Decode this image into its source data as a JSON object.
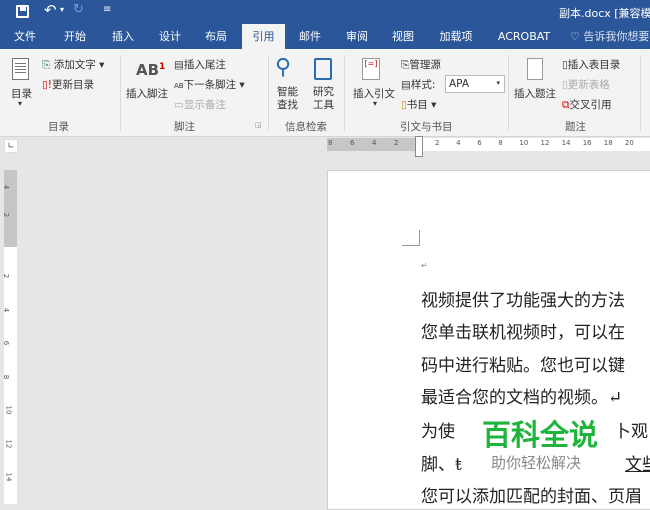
{
  "titlebar": {
    "title": "副本.docx [兼容模式]",
    "save_icon": "save-icon",
    "undo_icon": "undo-icon",
    "redo_icon": "redo-icon",
    "customize": "≡"
  },
  "tabs": [
    "文件",
    "开始",
    "插入",
    "设计",
    "布局",
    "引用",
    "邮件",
    "审阅",
    "视图",
    "加载项",
    "ACROBAT"
  ],
  "active_tab": "引用",
  "tell_me": "告诉我你想要做什么",
  "ribbon": {
    "toc": {
      "label": "目录",
      "add_text": "添加文字",
      "update": "更新目录",
      "group": "目录"
    },
    "footnotes": {
      "insert_footnote": "插入脚注",
      "insert_endnote": "插入尾注",
      "next_footnote": "下一条脚注",
      "show_notes": "显示备注",
      "group": "脚注"
    },
    "research": {
      "smart_lookup_1": "智能",
      "smart_lookup_2": "查找",
      "researcher_1": "研究",
      "researcher_2": "工具",
      "group": "信息检索"
    },
    "citations": {
      "insert_citation": "插入引文",
      "manage_sources": "管理源",
      "style_label": "样式:",
      "style_value": "APA",
      "bibliography": "书目",
      "group": "引文与书目"
    },
    "captions": {
      "insert_caption": "插入题注",
      "insert_table_figures": "插入表目录",
      "update_table": "更新表格",
      "cross_reference": "交叉引用",
      "group": "题注"
    }
  },
  "hruler": [
    "8",
    "6",
    "4",
    "2",
    "2",
    "4",
    "6",
    "8",
    "10",
    "12",
    "14",
    "16",
    "18",
    "20"
  ],
  "vruler": [
    "4",
    "2",
    "2",
    "4",
    "6",
    "8",
    "10",
    "12",
    "14"
  ],
  "document": {
    "lines": [
      "视频提供了功能强大的方法",
      "您单击联机视频时，可以在",
      "码中进行粘贴。您也可以键",
      "最适合您的文档的视频。↵",
      "为使",
      "脚、ŧ",
      "您可以添加匹配的封面、页眉"
    ],
    "line5_tail": "卜观",
    "line6_tail": "文些"
  },
  "watermark": {
    "title": "百科全说",
    "subtitle": "助你轻松解决"
  }
}
